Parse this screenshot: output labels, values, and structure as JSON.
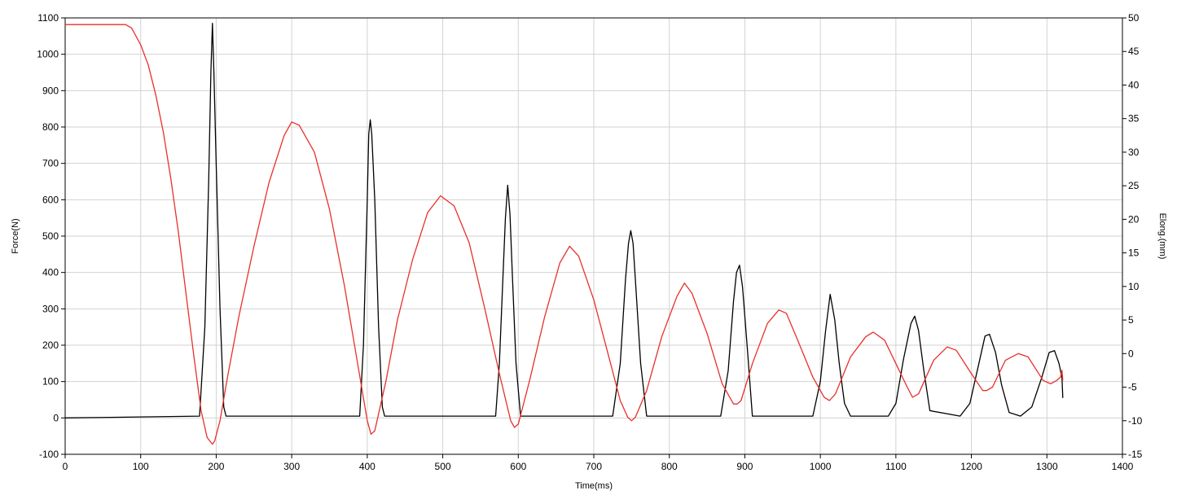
{
  "chart_data": {
    "type": "line",
    "xlabel": "Time(ms)",
    "ylabel_left": "Force(N)",
    "ylabel_right": "Elong.(mm)",
    "xlim": [
      0,
      1400
    ],
    "ylim_left": [
      -100,
      1100
    ],
    "ylim_right": [
      -15,
      50
    ],
    "x_ticks": [
      0,
      100,
      200,
      300,
      400,
      500,
      600,
      700,
      800,
      900,
      1000,
      1100,
      1200,
      1300,
      1400
    ],
    "y_left_ticks": [
      -100,
      0,
      100,
      200,
      300,
      400,
      500,
      600,
      700,
      800,
      900,
      1000,
      1100
    ],
    "y_right_ticks": [
      -15,
      -10,
      -5,
      0,
      5,
      10,
      15,
      20,
      25,
      30,
      35,
      40,
      45,
      50
    ],
    "grid": true,
    "colors": {
      "force": "#000000",
      "elong": "#e8302a",
      "grid": "#d2d2d2",
      "axis": "#000000"
    },
    "series": [
      {
        "axis": "left",
        "color": "#000000",
        "x": [
          0,
          80,
          178,
          185,
          190,
          193,
          195,
          197,
          200,
          205,
          210,
          213,
          390,
          395,
          400,
          402,
          404,
          406,
          410,
          415,
          420,
          423,
          570,
          575,
          580,
          583,
          586,
          589,
          592,
          597,
          603,
          725,
          735,
          742,
          746,
          749,
          752,
          756,
          762,
          770,
          868,
          878,
          885,
          889,
          893,
          897,
          903,
          910,
          990,
          1000,
          1007,
          1013,
          1019,
          1025,
          1032,
          1040,
          1090,
          1100,
          1110,
          1120,
          1125,
          1130,
          1137,
          1145,
          1185,
          1198,
          1210,
          1218,
          1224,
          1232,
          1240,
          1250,
          1265,
          1280,
          1293,
          1303,
          1310,
          1316,
          1320,
          1321
        ],
        "values": [
          0,
          2,
          5,
          250,
          650,
          950,
          1085,
          950,
          700,
          300,
          30,
          5,
          5,
          200,
          600,
          780,
          820,
          780,
          600,
          250,
          30,
          5,
          5,
          150,
          400,
          550,
          640,
          560,
          400,
          150,
          5,
          5,
          150,
          380,
          480,
          515,
          480,
          350,
          150,
          5,
          5,
          130,
          320,
          400,
          420,
          360,
          200,
          5,
          5,
          100,
          240,
          340,
          270,
          150,
          40,
          5,
          5,
          40,
          160,
          260,
          280,
          240,
          130,
          20,
          5,
          40,
          150,
          225,
          230,
          180,
          90,
          15,
          5,
          30,
          110,
          180,
          185,
          150,
          110,
          55
        ]
      },
      {
        "axis": "right",
        "color": "#e8302a",
        "x": [
          0,
          80,
          88,
          100,
          110,
          120,
          130,
          140,
          150,
          160,
          170,
          180,
          188,
          195,
          198,
          205,
          215,
          230,
          250,
          270,
          290,
          300,
          310,
          330,
          350,
          370,
          385,
          400,
          405,
          410,
          425,
          440,
          460,
          480,
          497,
          515,
          535,
          555,
          575,
          590,
          595,
          600,
          615,
          635,
          655,
          668,
          680,
          700,
          720,
          735,
          745,
          750,
          755,
          770,
          790,
          810,
          820,
          830,
          850,
          870,
          885,
          890,
          895,
          910,
          930,
          945,
          955,
          970,
          990,
          1005,
          1012,
          1020,
          1040,
          1060,
          1070,
          1085,
          1100,
          1115,
          1122,
          1130,
          1150,
          1168,
          1180,
          1200,
          1215,
          1220,
          1228,
          1245,
          1262,
          1275,
          1295,
          1305,
          1313,
          1318,
          1320,
          1321
        ],
        "values": [
          49,
          49,
          48.5,
          46,
          43,
          38.5,
          33,
          26,
          18,
          9,
          0,
          -8.5,
          -12.5,
          -13.5,
          -13,
          -10,
          -3.5,
          5.5,
          16,
          25.5,
          32.5,
          34.5,
          34,
          30,
          21.5,
          10,
          0,
          -10,
          -12,
          -11.5,
          -4,
          5,
          14,
          21,
          23.5,
          22,
          16.5,
          7,
          -3,
          -10,
          -11,
          -10.5,
          -4,
          5.5,
          13.5,
          16,
          14.5,
          8,
          -0.5,
          -7,
          -9.5,
          -10,
          -9.5,
          -5.5,
          2.5,
          8.5,
          10.5,
          9,
          3,
          -4.5,
          -7.5,
          -7.5,
          -7,
          -1.5,
          4.5,
          6.5,
          6,
          2,
          -3.5,
          -6.5,
          -7,
          -6,
          -0.5,
          2.5,
          3.2,
          2,
          -1.5,
          -5,
          -6.5,
          -6,
          -1,
          1,
          0.5,
          -3,
          -5.5,
          -5.5,
          -5,
          -1,
          0,
          -0.5,
          -4,
          -4.5,
          -4,
          -3.5,
          -2.5,
          -4
        ]
      }
    ]
  }
}
